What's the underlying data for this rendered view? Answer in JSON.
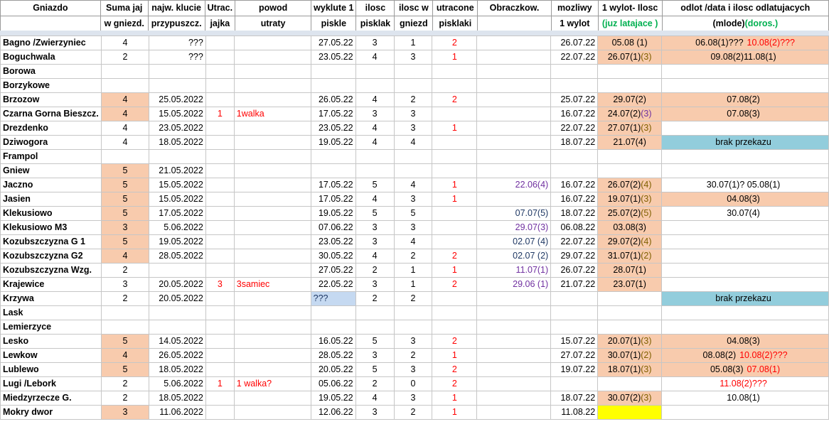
{
  "headers": {
    "row1": [
      "Gniazdo",
      "Suma jaj",
      "najw. klucie",
      "Utrac.",
      "powod",
      "wyklute 1",
      "ilosc",
      "ilosc w",
      "utracone",
      "Obraczkow.",
      "mozliwy",
      "1 wylot- Ilosc",
      "odlot /data i ilosc odlatujacych"
    ],
    "row2": [
      "",
      "w gniezd.",
      "przypuszcz.",
      "jajka",
      "utraty",
      "piskle",
      "pisklak",
      "gniezd",
      "pisklaki",
      "",
      "1 wylot",
      "(juz latajace )",
      "(mlode)",
      "(doros.)"
    ]
  },
  "rows": [
    {
      "name": "Bagno /Zwierzyniec",
      "suma": "4",
      "klucie": "???",
      "utrac": "",
      "powod": "",
      "wyklute": "27.05.22",
      "ilosc": "3",
      "gniezd": "1",
      "utracone": "2",
      "obracz": "",
      "mozliwy": "26.07.22",
      "wylot_a": "05.08 (1)",
      "wylot_b": "",
      "odlot_a": "06.08(1)???",
      "odlot_b": "10.08(2)???"
    },
    {
      "name": "Boguchwala",
      "suma": "2",
      "klucie": "???",
      "utrac": "",
      "powod": "",
      "wyklute": "23.05.22",
      "ilosc": "4",
      "gniezd": "3",
      "utracone": "1",
      "obracz": "",
      "mozliwy": "22.07.22",
      "wylot_a": "26.07(1)",
      "wylot_b": "(3)",
      "odlot_a": "09.08(2)11.08(1)",
      "odlot_b": ""
    },
    {
      "name": "Borowa",
      "suma": "",
      "klucie": "",
      "utrac": "",
      "powod": "",
      "wyklute": "",
      "ilosc": "",
      "gniezd": "",
      "utracone": "",
      "obracz": "",
      "mozliwy": "",
      "wylot_a": "",
      "wylot_b": "",
      "odlot_a": "",
      "odlot_b": ""
    },
    {
      "name": "Borzykowe",
      "suma": "",
      "klucie": "",
      "utrac": "",
      "powod": "",
      "wyklute": "",
      "ilosc": "",
      "gniezd": "",
      "utracone": "",
      "obracz": "",
      "mozliwy": "",
      "wylot_a": "",
      "wylot_b": "",
      "odlot_a": "",
      "odlot_b": ""
    },
    {
      "name": "Brzozow",
      "suma": "4",
      "klucie": "25.05.2022",
      "utrac": "",
      "powod": "",
      "wyklute": "26.05.22",
      "ilosc": "4",
      "gniezd": "2",
      "utracone": "2",
      "obracz": "",
      "mozliwy": "25.07.22",
      "wylot_a": "29.07(2)",
      "wylot_b": "",
      "odlot_a": "07.08(2)",
      "odlot_b": ""
    },
    {
      "name": "Czarna Gorna Bieszcz.",
      "suma": "4",
      "klucie": "15.05.2022",
      "utrac": "1",
      "powod": "1walka",
      "wyklute": "17.05.22",
      "ilosc": "3",
      "gniezd": "3",
      "utracone": "",
      "obracz": "",
      "mozliwy": "16.07.22",
      "wylot_a": "24.07(2)",
      "wylot_b": "(3)",
      "odlot_a": "07.08(3)",
      "odlot_b": ""
    },
    {
      "name": "Drezdenko",
      "suma": "4",
      "klucie": "23.05.2022",
      "utrac": "",
      "powod": "",
      "wyklute": "23.05.22",
      "ilosc": "4",
      "gniezd": "3",
      "utracone": "1",
      "obracz": "",
      "mozliwy": "22.07.22",
      "wylot_a": "27.07(1)",
      "wylot_b": "(3)",
      "odlot_a": "",
      "odlot_b": ""
    },
    {
      "name": "Dziwogora",
      "suma": "4",
      "klucie": "18.05.2022",
      "utrac": "",
      "powod": "",
      "wyklute": "19.05.22",
      "ilosc": "4",
      "gniezd": "4",
      "utracone": "",
      "obracz": "",
      "mozliwy": "18.07.22",
      "wylot_a": "21.07(4)",
      "wylot_b": "",
      "odlot_a": "brak przekazu",
      "odlot_b": ""
    },
    {
      "name": "Frampol",
      "suma": "",
      "klucie": "",
      "utrac": "",
      "powod": "",
      "wyklute": "",
      "ilosc": "",
      "gniezd": "",
      "utracone": "",
      "obracz": "",
      "mozliwy": "",
      "wylot_a": "",
      "wylot_b": "",
      "odlot_a": "",
      "odlot_b": ""
    },
    {
      "name": "Gniew",
      "suma": "5",
      "klucie": "21.05.2022",
      "utrac": "",
      "powod": "",
      "wyklute": "",
      "ilosc": "",
      "gniezd": "",
      "utracone": "",
      "obracz": "",
      "mozliwy": "",
      "wylot_a": "",
      "wylot_b": "",
      "odlot_a": "",
      "odlot_b": ""
    },
    {
      "name": "Jaczno",
      "suma": "5",
      "klucie": "15.05.2022",
      "utrac": "",
      "powod": "",
      "wyklute": "17.05.22",
      "ilosc": "5",
      "gniezd": "4",
      "utracone": "1",
      "obracz": "22.06(4)",
      "mozliwy": "16.07.22",
      "wylot_a": "26.07(2)",
      "wylot_b": "(4)",
      "odlot_a": "30.07(1)? 05.08(1)",
      "odlot_b": ""
    },
    {
      "name": "Jasien",
      "suma": "5",
      "klucie": "15.05.2022",
      "utrac": "",
      "powod": "",
      "wyklute": "17.05.22",
      "ilosc": "4",
      "gniezd": "3",
      "utracone": "1",
      "obracz": "",
      "mozliwy": "16.07.22",
      "wylot_a": "19.07(1)",
      "wylot_b": "(3)",
      "odlot_a": "04.08(3)",
      "odlot_b": ""
    },
    {
      "name": "Klekusiowo",
      "suma": "5",
      "klucie": "17.05.2022",
      "utrac": "",
      "powod": "",
      "wyklute": "19.05.22",
      "ilosc": "5",
      "gniezd": "5",
      "utracone": "",
      "obracz": "07.07(5)",
      "mozliwy": "18.07.22",
      "wylot_a": "25.07(2)",
      "wylot_b": "(5)",
      "odlot_a": "30.07(4)",
      "odlot_b": ""
    },
    {
      "name": "Klekusiowo M3",
      "suma": "3",
      "klucie": "5.06.2022",
      "utrac": "",
      "powod": "",
      "wyklute": "07.06.22",
      "ilosc": "3",
      "gniezd": "3",
      "utracone": "",
      "obracz": "29.07(3)",
      "mozliwy": "06.08.22",
      "wylot_a": "03.08(3)",
      "wylot_b": "",
      "odlot_a": "",
      "odlot_b": ""
    },
    {
      "name": "Kozubszczyzna G 1",
      "suma": "5",
      "klucie": "19.05.2022",
      "utrac": "",
      "powod": "",
      "wyklute": "23.05.22",
      "ilosc": "3",
      "gniezd": "4",
      "utracone": "",
      "obracz": "02.07 (4)",
      "mozliwy": "22.07.22",
      "wylot_a": "29.07(2)",
      "wylot_b": "(4)",
      "odlot_a": "",
      "odlot_b": ""
    },
    {
      "name": "Kozubszczyzna G2",
      "suma": "4",
      "klucie": "28.05.2022",
      "utrac": "",
      "powod": "",
      "wyklute": "30.05.22",
      "ilosc": "4",
      "gniezd": "2",
      "utracone": "2",
      "obracz": "02.07 (2)",
      "mozliwy": "29.07.22",
      "wylot_a": "31.07(1)",
      "wylot_b": "(2)",
      "odlot_a": "",
      "odlot_b": ""
    },
    {
      "name": "Kozubszczyzna Wzg.",
      "suma": "2",
      "klucie": "",
      "utrac": "",
      "powod": "",
      "wyklute": "27.05.22",
      "ilosc": "2",
      "gniezd": "1",
      "utracone": "1",
      "obracz": "11.07(1)",
      "mozliwy": "26.07.22",
      "wylot_a": "28.07(1)",
      "wylot_b": "",
      "odlot_a": "",
      "odlot_b": ""
    },
    {
      "name": "Krajewice",
      "suma": "3",
      "klucie": "20.05.2022",
      "utrac": "3",
      "powod": "3samiec",
      "wyklute": "22.05.22",
      "ilosc": "3",
      "gniezd": "1",
      "utracone": "2",
      "obracz": "29.06 (1)",
      "mozliwy": "21.07.22",
      "wylot_a": "23.07(1)",
      "wylot_b": "",
      "odlot_a": "",
      "odlot_b": ""
    },
    {
      "name": "Krzywa",
      "suma": "2",
      "klucie": "20.05.2022",
      "utrac": "",
      "powod": "",
      "wyklute": "???",
      "ilosc": "2",
      "gniezd": "2",
      "utracone": "",
      "obracz": "",
      "mozliwy": "",
      "wylot_a": "",
      "wylot_b": "",
      "odlot_a": "brak przekazu",
      "odlot_b": ""
    },
    {
      "name": "Lask",
      "suma": "",
      "klucie": "",
      "utrac": "",
      "powod": "",
      "wyklute": "",
      "ilosc": "",
      "gniezd": "",
      "utracone": "",
      "obracz": "",
      "mozliwy": "",
      "wylot_a": "",
      "wylot_b": "",
      "odlot_a": "",
      "odlot_b": ""
    },
    {
      "name": "Lemierzyce",
      "suma": "",
      "klucie": "",
      "utrac": "",
      "powod": "",
      "wyklute": "",
      "ilosc": "",
      "gniezd": "",
      "utracone": "",
      "obracz": "",
      "mozliwy": "",
      "wylot_a": "",
      "wylot_b": "",
      "odlot_a": "",
      "odlot_b": ""
    },
    {
      "name": "Lesko",
      "suma": "5",
      "klucie": "14.05.2022",
      "utrac": "",
      "powod": "",
      "wyklute": "16.05.22",
      "ilosc": "5",
      "gniezd": "3",
      "utracone": "2",
      "obracz": "",
      "mozliwy": "15.07.22",
      "wylot_a": "20.07(1)",
      "wylot_b": "(3)",
      "odlot_a": "04.08(3)",
      "odlot_b": ""
    },
    {
      "name": "Lewkow",
      "suma": "4",
      "klucie": "26.05.2022",
      "utrac": "",
      "powod": "",
      "wyklute": "28.05.22",
      "ilosc": "3",
      "gniezd": "2",
      "utracone": "1",
      "obracz": "",
      "mozliwy": "27.07.22",
      "wylot_a": "30.07(1)",
      "wylot_b": "(2)",
      "odlot_a": "08.08(2)",
      "odlot_b": "10.08(2)???"
    },
    {
      "name": "Lublewo",
      "suma": "5",
      "klucie": "18.05.2022",
      "utrac": "",
      "powod": "",
      "wyklute": "20.05.22",
      "ilosc": "5",
      "gniezd": "3",
      "utracone": "2",
      "obracz": "",
      "mozliwy": "19.07.22",
      "wylot_a": "18.07(1)",
      "wylot_b": "(3)",
      "odlot_a": "05.08(3)",
      "odlot_b": "07.08(1)"
    },
    {
      "name": "Lugi /Lebork",
      "suma": "2",
      "klucie": "5.06.2022",
      "utrac": "1",
      "powod": "1 walka?",
      "wyklute": "05.06.22",
      "ilosc": "2",
      "gniezd": "0",
      "utracone": "2",
      "obracz": "",
      "mozliwy": "",
      "wylot_a": "",
      "wylot_b": "",
      "odlot_a": "11.08(2)???",
      "odlot_b": ""
    },
    {
      "name": "Miedzyrzecze G.",
      "suma": "2",
      "klucie": "18.05.2022",
      "utrac": "",
      "powod": "",
      "wyklute": "19.05.22",
      "ilosc": "4",
      "gniezd": "3",
      "utracone": "1",
      "obracz": "",
      "mozliwy": "18.07.22",
      "wylot_a": "30.07(2)",
      "wylot_b": "(3)",
      "odlot_a": "10.08(1)",
      "odlot_b": ""
    },
    {
      "name": "Mokry dwor",
      "suma": "3",
      "klucie": "11.06.2022",
      "utrac": "",
      "powod": "",
      "wyklute": "12.06.22",
      "ilosc": "3",
      "gniezd": "2",
      "utracone": "1",
      "obracz": "",
      "mozliwy": "11.08.22",
      "wylot_a": "",
      "wylot_b": "",
      "odlot_a": "",
      "odlot_b": ""
    }
  ],
  "colors": {
    "orange": "#f8cbad",
    "blue": "#92cddc",
    "yellow": "#ffff00",
    "red": "#ff0000",
    "purple": "#7030a0",
    "green": "#00b050"
  }
}
